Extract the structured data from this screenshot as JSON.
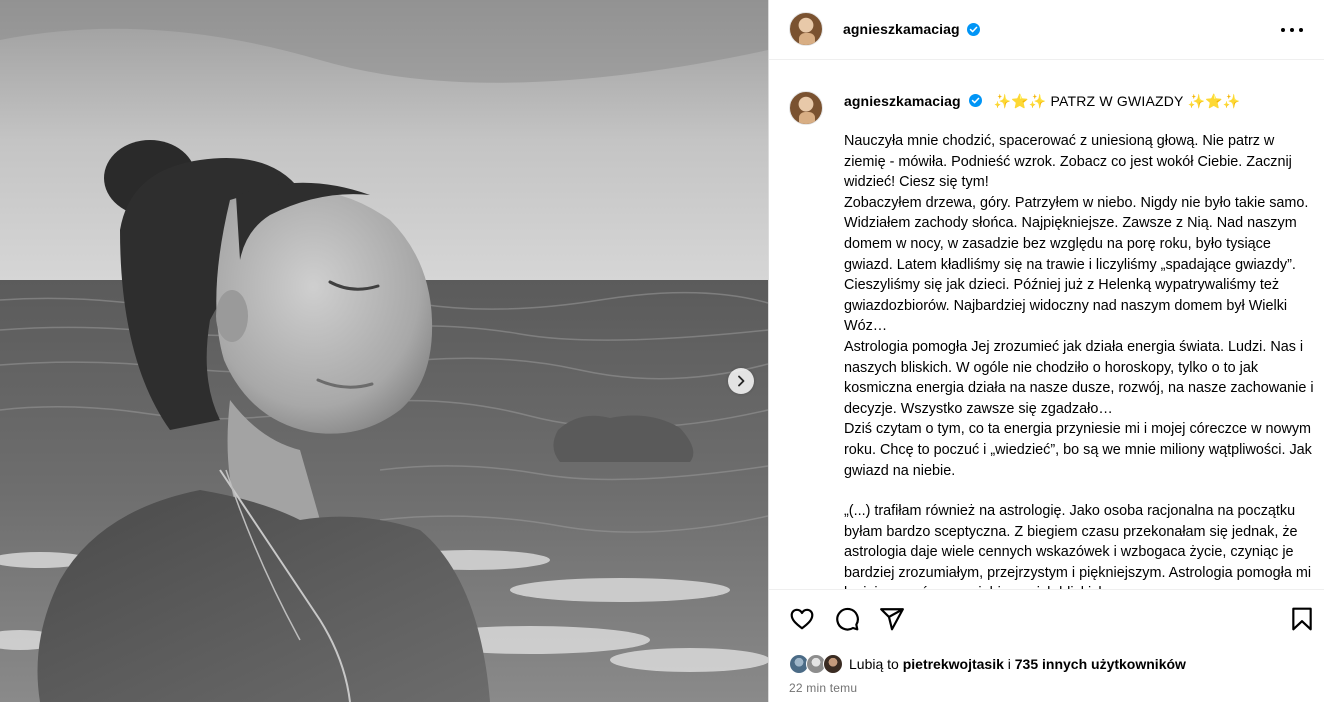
{
  "post": {
    "image_alt": "Czarno-białe zdjęcie kobiety nad morzem",
    "next_label": "Dalej"
  },
  "header": {
    "username": "agnieszkamaciag",
    "more_label": "⋯"
  },
  "caption": {
    "username": "agnieszkamaciag",
    "title_stars_left": "✨⭐✨",
    "title_text": "PATRZ W GWIAZDY",
    "title_stars_right": "✨⭐✨",
    "paragraphs": [
      "Nauczyła mnie chodzić, spacerować z uniesioną głową. Nie patrz w ziemię - mówiła. Podnieść wzrok. Zobacz co jest wokół Ciebie. Zacznij widzieć! Ciesz się tym!",
      "Zobaczyłem drzewa, góry. Patrzyłem w niebo. Nigdy nie było takie samo. Widziałem zachody słońca. Najpiękniejsze. Zawsze z Nią. Nad naszym domem w nocy, w zasadzie bez względu na porę roku, było tysiące gwiazd. Latem kładliśmy się na trawie i liczyliśmy „spadające gwiazdy”. Cieszyliśmy się jak dzieci. Później już z Helenką wypatrywaliśmy też gwiazdozbiorów. Najbardziej widoczny nad naszym domem był Wielki Wóz…",
      "Astrologia pomogła Jej zrozumieć jak działa energia świata. Ludzi. Nas i naszych bliskich. W ogóle nie chodziło o horoskopy, tylko o to jak kosmiczna energia działa na nasze dusze, rozwój, na nasze zachowanie i decyzje. Wszystko zawsze się zgadzało…",
      "Dziś czytam o tym, co ta energia przyniesie mi i mojej córeczce w nowym roku. Chcę to poczuć i „wiedzieć”, bo są we mnie miliony wątpliwości. Jak gwiazd na niebie.",
      "„(...) trafiłam również na astrologię. Jako osoba racjonalna na początku byłam bardzo sceptyczna. Z biegiem czasu przekonałam się jednak, że astrologia daje wiele cennych wskazówek i wzbogaca życie, czyniąc je bardziej zrozumiałym, przejrzystym i piękniejszym. Astrologia pomogła mi lepiej poznać samą siebie, moich bliskich"
    ]
  },
  "actions": {
    "like_icon": "heart-icon",
    "comment_icon": "comment-icon",
    "share_icon": "share-icon",
    "save_icon": "bookmark-icon"
  },
  "likes": {
    "prefix": "Lubią to ",
    "first_user": "pietrekwojtasik",
    "middle": " i ",
    "others": "735 innych użytkowników"
  },
  "timestamp": "22 min temu",
  "colors": {
    "verified_blue": "#0095f6",
    "secondary_text": "#737373",
    "border": "#dbdbdb"
  }
}
